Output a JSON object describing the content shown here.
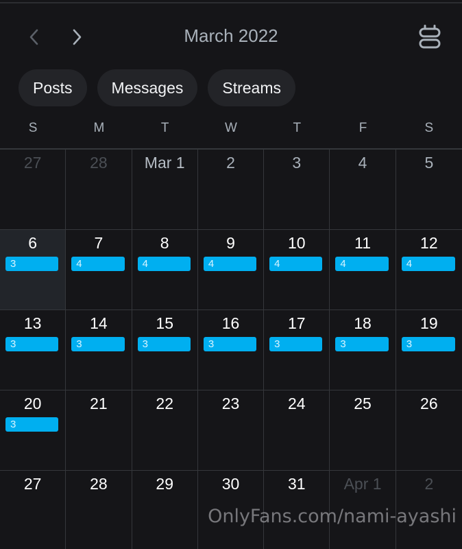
{
  "header": {
    "title": "March 2022",
    "prev_icon": "chevron-left-icon",
    "next_icon": "chevron-right-icon",
    "view_icon": "calendar-view-toggle-icon"
  },
  "filters": [
    {
      "label": "Posts"
    },
    {
      "label": "Messages"
    },
    {
      "label": "Streams"
    }
  ],
  "weekdays": [
    "S",
    "M",
    "T",
    "W",
    "T",
    "F",
    "S"
  ],
  "colors": {
    "accent": "#00aff0",
    "background": "#151518",
    "chip": "#232428"
  },
  "weeks": [
    [
      {
        "label": "27",
        "state": "muted"
      },
      {
        "label": "28",
        "state": "muted"
      },
      {
        "label": "Mar 1",
        "state": "first"
      },
      {
        "label": "2",
        "state": "dim"
      },
      {
        "label": "3",
        "state": "dim"
      },
      {
        "label": "4",
        "state": "dim"
      },
      {
        "label": "5",
        "state": "dim"
      }
    ],
    [
      {
        "label": "6",
        "count": "3",
        "selected": true
      },
      {
        "label": "7",
        "count": "4"
      },
      {
        "label": "8",
        "count": "4"
      },
      {
        "label": "9",
        "count": "4"
      },
      {
        "label": "10",
        "count": "4"
      },
      {
        "label": "11",
        "count": "4"
      },
      {
        "label": "12",
        "count": "4"
      }
    ],
    [
      {
        "label": "13",
        "count": "3"
      },
      {
        "label": "14",
        "count": "3"
      },
      {
        "label": "15",
        "count": "3"
      },
      {
        "label": "16",
        "count": "3"
      },
      {
        "label": "17",
        "count": "3"
      },
      {
        "label": "18",
        "count": "3"
      },
      {
        "label": "19",
        "count": "3"
      }
    ],
    [
      {
        "label": "20",
        "count": "3"
      },
      {
        "label": "21"
      },
      {
        "label": "22"
      },
      {
        "label": "23"
      },
      {
        "label": "24"
      },
      {
        "label": "25"
      },
      {
        "label": "26"
      }
    ],
    [
      {
        "label": "27"
      },
      {
        "label": "28"
      },
      {
        "label": "29"
      },
      {
        "label": "30"
      },
      {
        "label": "31"
      },
      {
        "label": "Apr 1",
        "state": "muted"
      },
      {
        "label": "2",
        "state": "muted"
      }
    ]
  ],
  "watermark": "OnlyFans.com/nami-ayashi"
}
